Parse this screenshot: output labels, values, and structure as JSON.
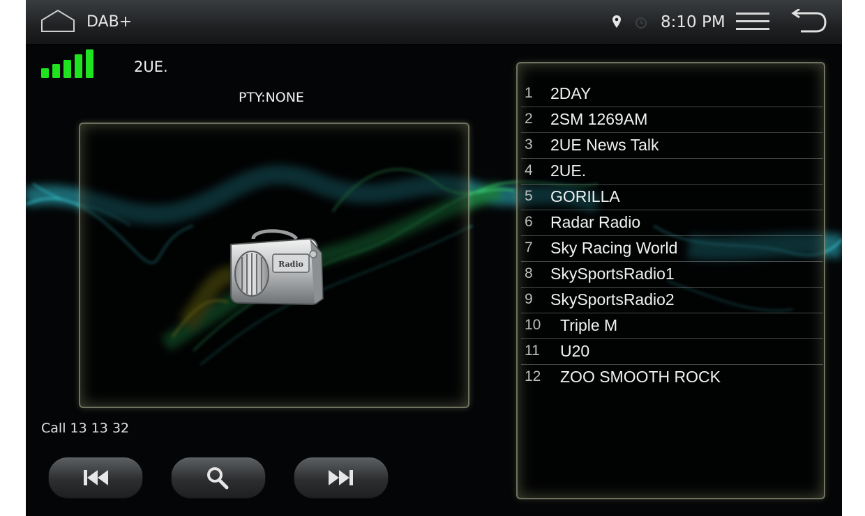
{
  "statusbar": {
    "app_title": "DAB+",
    "time": "8:10 PM",
    "icons": [
      "home-icon",
      "location-icon",
      "clock-icon",
      "menu-icon",
      "back-icon"
    ]
  },
  "now_playing": {
    "station": "2UE.",
    "pty": "PTY:NONE",
    "signal_level": 5,
    "signal_max": 5,
    "signal_color": "#1fe31f",
    "artwork_icon": "radio-icon",
    "radio_label": "Radio",
    "dls_text": "Call 13 13 32"
  },
  "controls": {
    "prev_icon": "skip-previous-icon",
    "search_icon": "search-icon",
    "next_icon": "skip-next-icon"
  },
  "stations": [
    {
      "num": "1",
      "name": "2DAY"
    },
    {
      "num": "2",
      "name": "2SM 1269AM"
    },
    {
      "num": "3",
      "name": "2UE News Talk"
    },
    {
      "num": "4",
      "name": "2UE."
    },
    {
      "num": "5",
      "name": "GORILLA"
    },
    {
      "num": "6",
      "name": "Radar Radio"
    },
    {
      "num": "7",
      "name": "Sky Racing World"
    },
    {
      "num": "8",
      "name": "SkySportsRadio1"
    },
    {
      "num": "9",
      "name": "SkySportsRadio2"
    },
    {
      "num": "10",
      "name": "Triple M"
    },
    {
      "num": "11",
      "name": "U20"
    },
    {
      "num": "12",
      "name": "ZOO SMOOTH ROCK"
    }
  ],
  "colors": {
    "background": "#040506",
    "panel_border": "#c8cdaa",
    "smoke_green": "#2fd66a",
    "smoke_cyan": "#2fb9c9",
    "smoke_yellow": "#c4c21e"
  }
}
